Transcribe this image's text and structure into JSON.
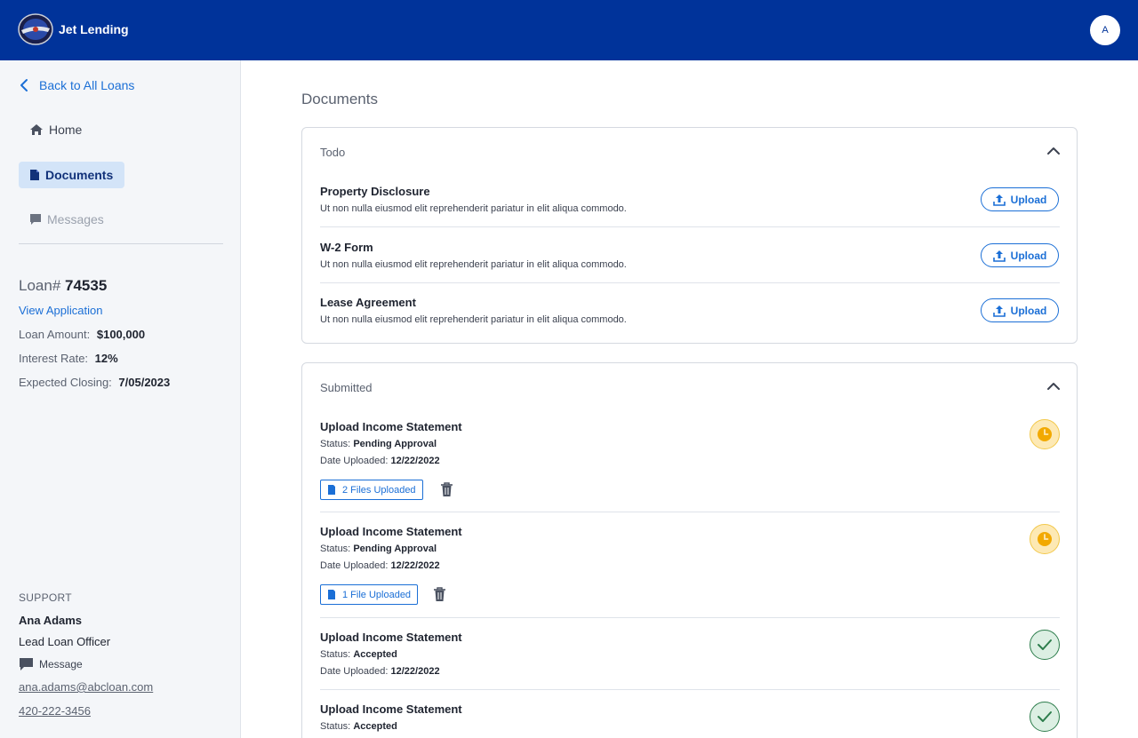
{
  "header": {
    "brand": "Jet Lending",
    "avatar_initial": "A"
  },
  "sidebar": {
    "back_label": "Back to All Loans",
    "nav": [
      {
        "label": "Home",
        "icon": "home-icon",
        "active": false
      },
      {
        "label": "Documents",
        "icon": "document-icon",
        "active": true
      },
      {
        "label": "Messages",
        "icon": "chat-icon",
        "active": false
      }
    ],
    "loan": {
      "prefix": "Loan#",
      "number": "74535",
      "view_application": "View Application",
      "amount_label": "Loan Amount:",
      "amount": "$100,000",
      "rate_label": "Interest Rate:",
      "rate": "12%",
      "closing_label": "Expected Closing:",
      "closing": "7/05/2023"
    },
    "support": {
      "heading": "SUPPORT",
      "name": "Ana Adams",
      "role": "Lead Loan Officer",
      "message_label": "Message",
      "email": "ana.adams@abcloan.com",
      "phone": "420-222-3456"
    }
  },
  "main": {
    "title": "Documents",
    "todo": {
      "heading": "Todo",
      "upload_label": "Upload",
      "items": [
        {
          "title": "Property Disclosure",
          "desc": "Ut non nulla eiusmod elit reprehenderit pariatur in elit aliqua commodo."
        },
        {
          "title": "W-2 Form",
          "desc": "Ut non nulla eiusmod elit reprehenderit pariatur in elit aliqua commodo."
        },
        {
          "title": "Lease Agreement",
          "desc": "Ut non nulla eiusmod elit reprehenderit pariatur in elit aliqua commodo."
        }
      ]
    },
    "submitted": {
      "heading": "Submitted",
      "status_label": "Status:",
      "date_label": "Date Uploaded:",
      "items": [
        {
          "title": "Upload Income Statement",
          "status": "Pending Approval",
          "date": "12/22/2022",
          "files": "2 Files Uploaded",
          "state": "pending"
        },
        {
          "title": "Upload Income Statement",
          "status": "Pending Approval",
          "date": "12/22/2022",
          "files": "1 File Uploaded",
          "state": "pending"
        },
        {
          "title": "Upload Income Statement",
          "status": "Accepted",
          "date": "12/22/2022",
          "state": "accepted"
        },
        {
          "title": "Upload Income Statement",
          "status": "Accepted",
          "state": "accepted"
        }
      ]
    }
  },
  "colors": {
    "header": "#00339a",
    "accent": "#1b6fd6",
    "pending": "#f2c84b",
    "accepted": "#2d7d4c"
  }
}
